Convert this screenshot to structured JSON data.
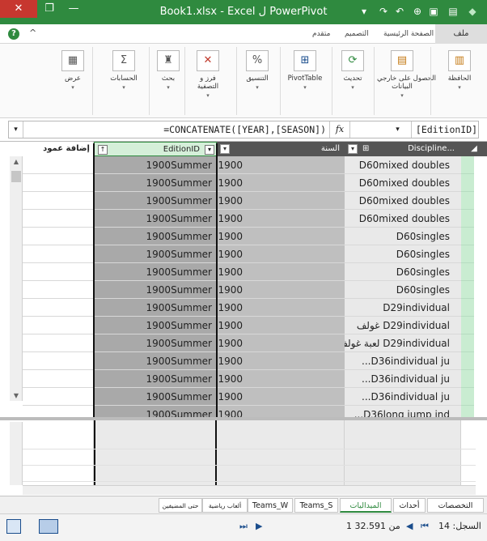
{
  "titlebar": {
    "title": "Book1.xlsx - Excel ل PowerPivot",
    "close": "✕",
    "restore": "❐",
    "minimize": "—",
    "qat_icons": [
      "excel-icon",
      "save-icon",
      "undo-icon",
      "redo-icon",
      "customize-icon"
    ]
  },
  "tabs": {
    "file": "ملف",
    "home": "الصفحة الرئيسية",
    "design": "التصميم",
    "advanced": "متقدم",
    "help": "?",
    "collapse": "^"
  },
  "ribbon": {
    "paste": "الحافظة",
    "get_external": "الحصول على خارجي",
    "get_external_2": "البيانات",
    "refresh": "تحديث",
    "pivottable": "PivotTable",
    "format": "التنسيق",
    "sort_filter": "فرز و",
    "sort_filter_2": "التصفية",
    "find": "بحث",
    "calculations": "الحسابات",
    "view": "عرض",
    "dropdown_glyph": "▾"
  },
  "formula_bar": {
    "name_box": "[EditionID]",
    "fx": "fx",
    "formula": "=CONCATENATE([YEAR],[SEASON])",
    "dd_glyph": "▾",
    "nav_glyph": "▾"
  },
  "columns": {
    "discipline": "Discipline...",
    "year": "السنة",
    "edition": "EditionID",
    "add_column": "إضافة عمود"
  },
  "rows": [
    {
      "discipline": "D60mixed doubles",
      "year": "1900",
      "edition": "1900Summer"
    },
    {
      "discipline": "D60mixed doubles",
      "year": "1900",
      "edition": "1900Summer"
    },
    {
      "discipline": "D60mixed doubles",
      "year": "1900",
      "edition": "1900Summer"
    },
    {
      "discipline": "D60mixed doubles",
      "year": "1900",
      "edition": "1900Summer"
    },
    {
      "discipline": "D60singles",
      "year": "1900",
      "edition": "1900Summer"
    },
    {
      "discipline": "D60singles",
      "year": "1900",
      "edition": "1900Summer"
    },
    {
      "discipline": "D60singles",
      "year": "1900",
      "edition": "1900Summer"
    },
    {
      "discipline": "D60singles",
      "year": "1900",
      "edition": "1900Summer"
    },
    {
      "discipline": "D29individual",
      "year": "1900",
      "edition": "1900Summer"
    },
    {
      "discipline": "D29individual غولف",
      "year": "1900",
      "edition": "1900Summer"
    },
    {
      "discipline": "D29individual لعبة غولف",
      "year": "1900",
      "edition": "1900Summer"
    },
    {
      "discipline": "D36individual ju...",
      "year": "1900",
      "edition": "1900Summer"
    },
    {
      "discipline": "D36individual ju...",
      "year": "1900",
      "edition": "1900Summer"
    },
    {
      "discipline": "D36individual ju...",
      "year": "1900",
      "edition": "1900Summer"
    },
    {
      "discipline": "D36long jump ind...",
      "year": "1900",
      "edition": "1900Summer"
    }
  ],
  "sheets": [
    {
      "label": "التخصصات"
    },
    {
      "label": "أحداث"
    },
    {
      "label": "الميداليات"
    },
    {
      "label": "Teams_S"
    },
    {
      "label": "Teams_W"
    },
    {
      "label": "ألعاب رياضية"
    },
    {
      "label": "حتى المضيفين"
    }
  ],
  "status": {
    "record_label": "السجل: 14",
    "of_total": "1 من 32.591",
    "first": "⏮",
    "prev": "◀",
    "next": "▶",
    "last": "⏭"
  }
}
